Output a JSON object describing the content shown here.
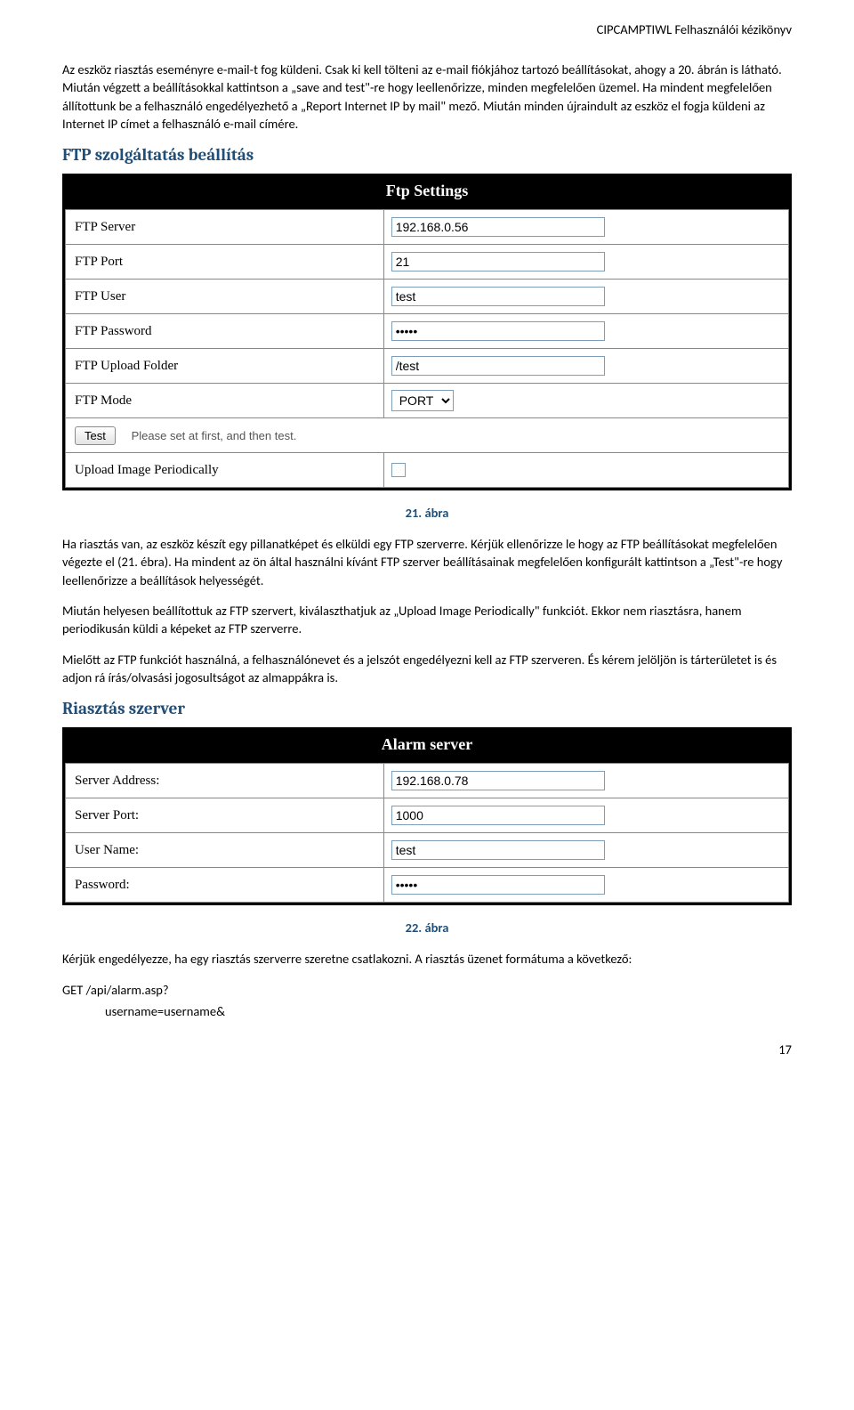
{
  "header": {
    "text": "CIPCAMPTIWL  Felhasználói kézikönyv"
  },
  "para1": "Az eszköz riasztás eseményre e-mail-t fog küldeni. Csak ki kell tölteni az e-mail fiókjához tartozó beállításokat, ahogy a 20. ábrán is látható. Miután végzett a beállításokkal kattintson a „save and test\"-re hogy leellenőrizze, minden megfelelően üzemel. Ha mindent megfelelően állítottunk be a felhasználó engedélyezhető a „Report Internet IP by mail\" mező. Miután minden újraindult az eszköz el fogja küldeni az Internet IP címet a felhasználó e-mail címére.",
  "section_ftp": "FTP szolgáltatás beállítás",
  "ftp_panel": {
    "title": "Ftp Settings",
    "rows": [
      {
        "label": "FTP Server",
        "value": "192.168.0.56"
      },
      {
        "label": "FTP Port",
        "value": "21"
      },
      {
        "label": "FTP User",
        "value": "test"
      },
      {
        "label": "FTP Password",
        "value": "•••••"
      },
      {
        "label": "FTP Upload Folder",
        "value": "/test"
      },
      {
        "label": "FTP Mode",
        "value": "PORT"
      }
    ],
    "test_button": "Test",
    "test_hint": "Please set at first, and then test.",
    "upload_label": "Upload Image Periodically"
  },
  "caption21": "21. ábra",
  "para2": "Ha riasztás van, az eszköz készít egy pillanatképet és elküldi egy FTP szerverre. Kérjük ellenőrizze le hogy az FTP beállításokat megfelelően végezte el (21. ébra). Ha mindent az ön által használni kívánt FTP szerver beállításainak megfelelően konfigurált kattintson a „Test\"-re hogy leellenőrizze a beállítások helyességét.",
  "para3": "Miután helyesen beállítottuk az FTP szervert, kiválaszthatjuk az „Upload Image Periodically\" funkciót. Ekkor nem riasztásra, hanem periodikusán küldi a képeket az FTP szerverre.",
  "para4": "Mielőtt az FTP funkciót használná, a felhasználónevet és a jelszót engedélyezni kell az FTP szerveren. És kérem jelöljön is tárterületet is és adjon rá írás/olvasási jogosultságot az almappákra is.",
  "section_alarm": "Riasztás szerver",
  "alarm_panel": {
    "title": "Alarm server",
    "rows": [
      {
        "label": "Server Address:",
        "value": "192.168.0.78"
      },
      {
        "label": "Server Port:",
        "value": "1000"
      },
      {
        "label": "User Name:",
        "value": "test"
      },
      {
        "label": "Password:",
        "value": "•••••"
      }
    ]
  },
  "caption22": "22. ábra",
  "para5": "Kérjük engedélyezze, ha egy riasztás szerverre szeretne csatlakozni. A riasztás üzenet formátuma a következő:",
  "code1": "GET /api/alarm.asp?",
  "code2": "username=username&",
  "page_number": "17"
}
